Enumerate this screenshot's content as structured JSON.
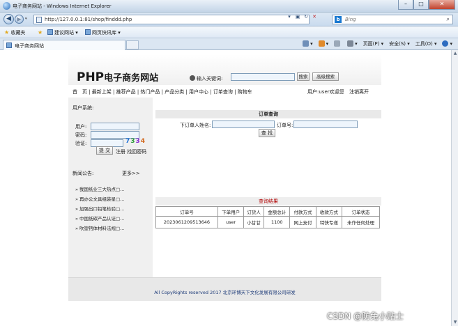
{
  "browser": {
    "window_title": "电子商务网站 - Windows Internet Explorer",
    "url": "http://127.0.0.1:81/shop/finddd.php",
    "search_placeholder": "Bing",
    "favorites_label": "收藏夹",
    "fav_items": [
      "建议网站 ▾",
      "网页快讯库 ▾"
    ],
    "tab_title": "电子商务网站",
    "commands": [
      "页面(P) ▾",
      "安全(S) ▾",
      "工具(O) ▾"
    ]
  },
  "site": {
    "logo": "PHP",
    "logo_cn": "电子商务网站",
    "search_label": "输入关键词:",
    "search_button": "搜索",
    "advanced_search_button": "高级搜索",
    "nav_links": "首　页 | 最新上架 | 推荐产品 | 热门产品 | 产品分类 | 用户中心 | 订单查询 | 购物车",
    "user_info": "用户:user欢迎您",
    "logout": "注销离开"
  },
  "sidebar": {
    "user_system_title": "用户系统:",
    "username_label": "用户:",
    "password_label": "密码:",
    "captcha_label": "验证:",
    "captcha_value": "7334",
    "submit_button": "提 交",
    "register_link": "注册",
    "forgot_link": "找回密码",
    "news_title": "新闻公告:",
    "more_link": "更多>>",
    "news_items": [
      "» 我国纸业三大热点□...",
      "» 再办公文具组装星□...",
      "» 加强出口铅笔检验□...",
      "» 中国纸碳产品认证□...",
      "» 吹塑钙体材料法规□..."
    ]
  },
  "order_query": {
    "section_title": "订单查询",
    "buyer_label": "下订单人姓名:",
    "order_no_label": "订单号:",
    "query_button": "查 找",
    "result_title": "查询结果",
    "columns": [
      "订单号",
      "下单用户",
      "订货人",
      "金额总计",
      "付款方式",
      "收款方式",
      "订单状态"
    ],
    "rows": [
      [
        "2023061209513646",
        "user",
        "小甘甘",
        "1100",
        "网上支付",
        "特快专递",
        "未作任何处理"
      ]
    ]
  },
  "footer": {
    "copyright": "All CopyRights reserved 2017 北京环博天下文化发展有限公司研发"
  },
  "watermark": "CSDN @防兔小贴士",
  "colors": {
    "captcha": [
      "#1a6fd8",
      "#2e9a3a",
      "#8a2bd2",
      "#d2691e"
    ],
    "result_title": "#b00000"
  }
}
